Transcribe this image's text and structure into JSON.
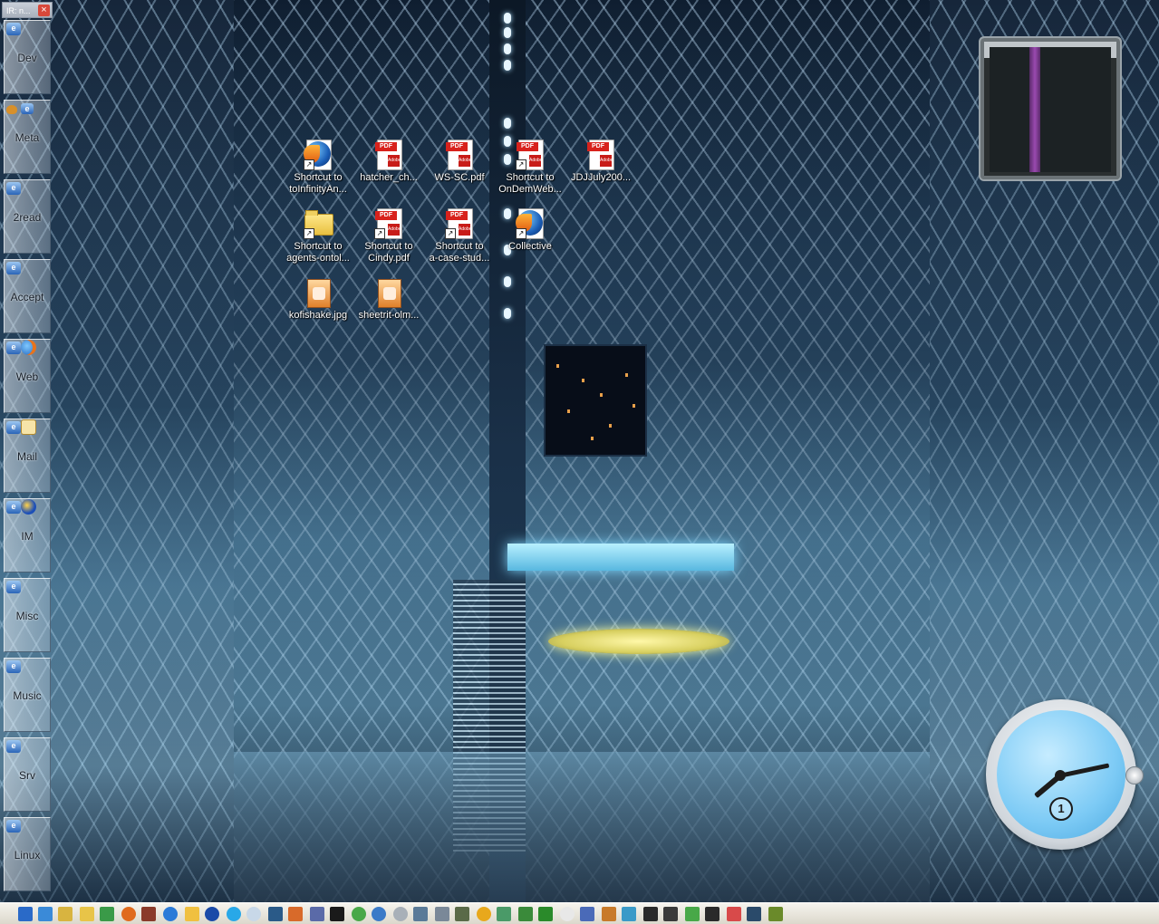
{
  "left_dock": {
    "title": "IR: n...",
    "close_label": "×",
    "buttons": [
      {
        "label": "Dev"
      },
      {
        "label": "Meta"
      },
      {
        "label": "2read"
      },
      {
        "label": "Accept"
      },
      {
        "label": "Web"
      },
      {
        "label": "Mail"
      },
      {
        "label": "IM"
      },
      {
        "label": "Misc"
      },
      {
        "label": "Music"
      },
      {
        "label": "Srv"
      },
      {
        "label": "Linux"
      }
    ]
  },
  "desktop_icons": [
    {
      "caption": "Shortcut to\ntoInfinityAn...",
      "icon": "firefox-document-icon"
    },
    {
      "caption": "hatcher_ch...",
      "icon": "pdf-icon"
    },
    {
      "caption": "WS-SC.pdf",
      "icon": "pdf-icon"
    },
    {
      "caption": "Shortcut to\nOnDemWeb...",
      "icon": "pdf-icon"
    },
    {
      "caption": "JDJJuly200...",
      "icon": "pdf-icon"
    },
    {
      "caption": "Shortcut to\nagents-ontol...",
      "icon": "folder-icon"
    },
    {
      "caption": "Shortcut to\nCindy.pdf",
      "icon": "pdf-icon"
    },
    {
      "caption": "Shortcut to\na-case-stud...",
      "icon": "pdf-icon"
    },
    {
      "caption": "Collective",
      "icon": "firefox-document-icon"
    },
    {
      "caption": "kofishake.jpg",
      "icon": "jpg-icon"
    },
    {
      "caption": "sheetrit-olm...",
      "icon": "jpg-icon"
    }
  ],
  "icon_labels": {
    "pdf_tag": "PDF",
    "adobe": "Adobe",
    "shortcut_arrow": "↗"
  },
  "clock": {
    "sub_dial": "1"
  },
  "taskbar": {
    "icons": [
      "firefox-icon",
      "iris-icon",
      "search-icon",
      "folder-icon",
      "network-icon",
      "firefox-icon",
      "picture-icon",
      "ie-icon",
      "clock-icon",
      "info-icon",
      "skype-icon",
      "chat-icon",
      "notes-icon",
      "butterfly-icon",
      "text-icon",
      "terminal-icon",
      "chrome-icon",
      "globe-icon",
      "disc-icon",
      "remote-icon",
      "tools-icon",
      "pen-icon",
      "media-icon",
      "music-icon",
      "frog-icon",
      "smiley-icon",
      "window-icon",
      "grid-icon",
      "users-icon",
      "window-icon",
      "window-icon",
      "run-icon",
      "window-icon",
      "arrow-icon",
      "eye-icon",
      "man-icon"
    ]
  },
  "colors": {
    "pdf_red": "#d8221c",
    "dock_label": "#141c26",
    "taskbar_bg": "#e8e4da"
  }
}
